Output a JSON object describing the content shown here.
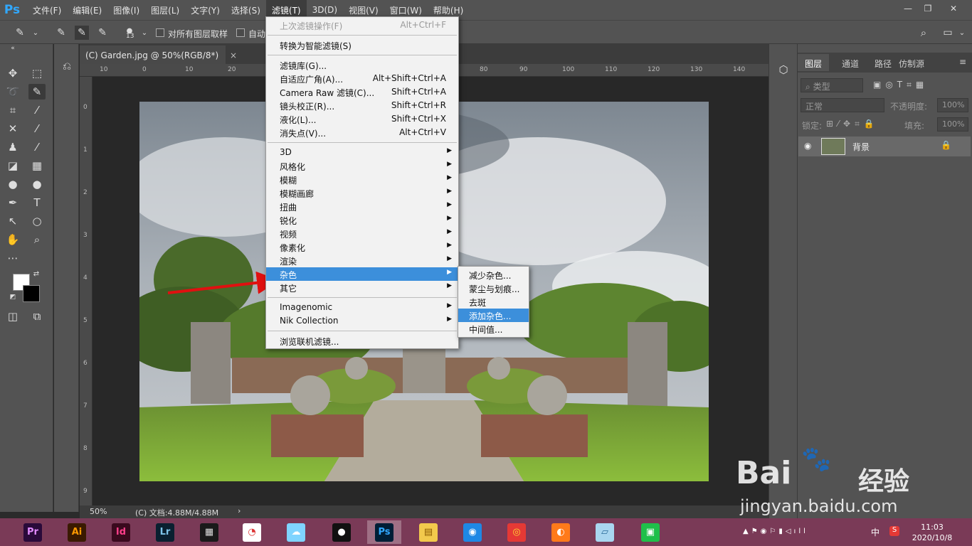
{
  "app": {
    "logo": "Ps"
  },
  "menubar": {
    "items": [
      "文件(F)",
      "编辑(E)",
      "图像(I)",
      "图层(L)",
      "文字(Y)",
      "选择(S)",
      "滤镜(T)",
      "3D(D)",
      "视图(V)",
      "窗口(W)",
      "帮助(H)"
    ],
    "active": "滤镜(T)"
  },
  "window_controls": {
    "minimize": "—",
    "restore": "❐",
    "close": "✕"
  },
  "options_bar": {
    "brush_size": "13",
    "sample_all_layers": "对所有图层取样",
    "auto_enhance": "自动"
  },
  "document": {
    "tab_title": "(C) Garden.jpg @ 50%(RGB/8*)",
    "zoom": "50%",
    "doc_info": "(C) 文档:4.88M/4.88M",
    "ruler_h": [
      "10",
      "0",
      "10",
      "20",
      "80",
      "90",
      "100",
      "110",
      "120",
      "130",
      "140"
    ],
    "ruler_v": [
      "0",
      "1",
      "2",
      "3",
      "4",
      "5",
      "6",
      "7",
      "8",
      "9"
    ]
  },
  "filter_menu": {
    "last_filter": {
      "label": "上次滤镜操作(F)",
      "shortcut": "Alt+Ctrl+F"
    },
    "smart_filter": "转换为智能滤镜(S)",
    "group1": [
      {
        "label": "滤镜库(G)...",
        "shortcut": ""
      },
      {
        "label": "自适应广角(A)...",
        "shortcut": "Alt+Shift+Ctrl+A"
      },
      {
        "label": "Camera Raw 滤镜(C)...",
        "shortcut": "Shift+Ctrl+A"
      },
      {
        "label": "镜头校正(R)...",
        "shortcut": "Shift+Ctrl+R"
      },
      {
        "label": "液化(L)...",
        "shortcut": "Shift+Ctrl+X"
      },
      {
        "label": "消失点(V)...",
        "shortcut": "Alt+Ctrl+V"
      }
    ],
    "group2": [
      "3D",
      "风格化",
      "模糊",
      "模糊画廊",
      "扭曲",
      "锐化",
      "视频",
      "像素化",
      "渲染",
      "杂色",
      "其它"
    ],
    "highlighted": "杂色",
    "group3": [
      "Imagenomic",
      "Nik Collection"
    ],
    "browse": "浏览联机滤镜..."
  },
  "noise_submenu": {
    "items": [
      "减少杂色...",
      "蒙尘与划痕...",
      "去斑",
      "添加杂色...",
      "中间值..."
    ],
    "highlighted": "添加杂色..."
  },
  "layers_panel": {
    "tabs": [
      "图层",
      "通道",
      "路径",
      "仿制源"
    ],
    "active_tab": "图层",
    "kind_filter": "类型",
    "blend_mode": "正常",
    "opacity_label": "不透明度:",
    "opacity_value": "100%",
    "lock_label": "锁定:",
    "fill_label": "填充:",
    "fill_value": "100%",
    "layers": [
      {
        "name": "背景",
        "locked": true,
        "visible": true
      }
    ]
  },
  "taskbar": {
    "apps": [
      {
        "name": "Premiere",
        "label": "Pr",
        "bg": "#2a0a3a",
        "fg": "#e28bff"
      },
      {
        "name": "Illustrator",
        "label": "Ai",
        "bg": "#3a1a00",
        "fg": "#ff9a00"
      },
      {
        "name": "InDesign",
        "label": "Id",
        "bg": "#3a0a1e",
        "fg": "#ff3e8a"
      },
      {
        "name": "Lightroom",
        "label": "Lr",
        "bg": "#0a2030",
        "fg": "#7dc3e8"
      },
      {
        "name": "Video",
        "label": "▦",
        "bg": "#1a1a1a",
        "fg": "#ddd"
      },
      {
        "name": "Player",
        "label": "◔",
        "bg": "#ffffff",
        "fg": "#d33"
      },
      {
        "name": "Chat",
        "label": "☁",
        "bg": "#7fd4ff",
        "fg": "#fff"
      },
      {
        "name": "QQ",
        "label": "●",
        "bg": "#111",
        "fg": "#fff"
      },
      {
        "name": "Photoshop",
        "label": "Ps",
        "bg": "#001e36",
        "fg": "#31a8ff"
      },
      {
        "name": "Explorer",
        "label": "▤",
        "bg": "#f2c94c",
        "fg": "#8a5a00"
      },
      {
        "name": "Browser",
        "label": "◉",
        "bg": "#1e88e5",
        "fg": "#fff"
      },
      {
        "name": "Chrome",
        "label": "◎",
        "bg": "#e53935",
        "fg": "#fdd835"
      },
      {
        "name": "Orange",
        "label": "◐",
        "bg": "#ff7a1a",
        "fg": "#fff"
      },
      {
        "name": "Notes",
        "label": "▱",
        "bg": "#a9d6f0",
        "fg": "#2b6c9a"
      },
      {
        "name": "Green",
        "label": "▣",
        "bg": "#1fbf4a",
        "fg": "#fff"
      }
    ],
    "active_app": "Photoshop",
    "tray_ime": "中",
    "time": "11:03",
    "date": "2020/10/8"
  },
  "watermark": {
    "brand": "Bai",
    "brand_cn": "经验",
    "url": "jingyan.baidu.com"
  }
}
